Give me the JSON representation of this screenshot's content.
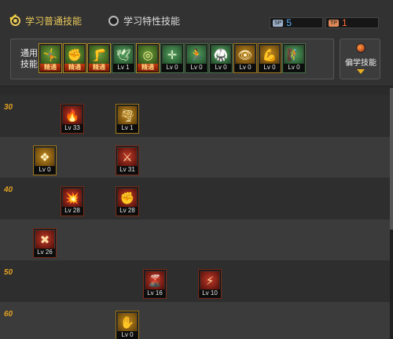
{
  "header": {
    "tab_normal": "学习普通技能",
    "tab_special": "学习特性技能",
    "sp": {
      "tag": "SP",
      "value": "5"
    },
    "tp": {
      "tag": "TP",
      "value": "1"
    },
    "common_label": "通用技能",
    "learn_button": "偏学技能"
  },
  "common_skills": [
    {
      "icon": "acrobat-icon",
      "glyph": "🤸",
      "style": "goldgreen",
      "label": "精通",
      "tag": true
    },
    {
      "icon": "grab-icon",
      "glyph": "✊",
      "style": "goldgreen",
      "label": "精通",
      "tag": true
    },
    {
      "icon": "kick-icon",
      "glyph": "🦵",
      "style": "goldgreen",
      "label": "精通",
      "tag": true
    },
    {
      "icon": "wings-icon",
      "glyph": "🕊",
      "style": "green",
      "label": "Lv 1",
      "tag": false
    },
    {
      "icon": "target-icon",
      "glyph": "◎",
      "style": "goldgreen",
      "label": "精通",
      "tag": true
    },
    {
      "icon": "crosshair-icon",
      "glyph": "✛",
      "style": "green",
      "label": "Lv 0",
      "tag": false
    },
    {
      "icon": "runner-icon",
      "glyph": "🏃",
      "style": "green",
      "label": "Lv 0",
      "tag": false
    },
    {
      "icon": "fighter-icon",
      "glyph": "🥋",
      "style": "green",
      "label": "Lv 0",
      "tag": false
    },
    {
      "icon": "eye-icon",
      "glyph": "👁",
      "style": "gold",
      "label": "Lv 0",
      "tag": false
    },
    {
      "icon": "strongman-icon",
      "glyph": "💪",
      "style": "gold",
      "label": "Lv 0",
      "tag": false
    },
    {
      "icon": "climber-icon",
      "glyph": "🧗",
      "style": "green",
      "label": "Lv 0",
      "tag": false
    }
  ],
  "rows": [
    {
      "level": "30",
      "skills": [
        {
          "icon": "fire-trap-icon",
          "glyph": "🔥",
          "style": "red",
          "label": "Lv 33"
        },
        {
          "icon": "tornado-icon",
          "glyph": "🌪",
          "style": "gold",
          "label": "Lv 1"
        }
      ]
    },
    {
      "level": "",
      "skills": [
        {
          "icon": "rune-icon",
          "glyph": "❖",
          "style": "gold",
          "label": "Lv 0"
        },
        {
          "icon": "slash-icon",
          "glyph": "⚔",
          "style": "red",
          "label": "Lv 31"
        }
      ]
    },
    {
      "level": "40",
      "skills": [
        {
          "icon": "fire-burst-icon",
          "glyph": "💥",
          "style": "red",
          "label": "Lv 28"
        },
        {
          "icon": "fire-fist-icon",
          "glyph": "✊",
          "style": "red",
          "label": "Lv 28"
        }
      ]
    },
    {
      "level": "",
      "skills": [
        {
          "icon": "cross-blade-icon",
          "glyph": "✖",
          "style": "red",
          "label": "Lv 26"
        }
      ]
    },
    {
      "level": "50",
      "skills": [
        {
          "icon": "flame-wave-icon",
          "glyph": "🌋",
          "style": "red",
          "label": "Lv 16"
        },
        {
          "icon": "lightning-icon",
          "glyph": "⚡",
          "style": "red",
          "label": "Lv 10"
        }
      ]
    },
    {
      "level": "60",
      "skills": [
        {
          "icon": "palm-icon",
          "glyph": "✋",
          "style": "gold",
          "label": "Lv 0"
        }
      ]
    }
  ]
}
